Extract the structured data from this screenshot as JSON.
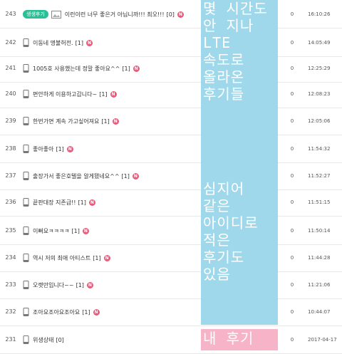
{
  "rows": [
    {
      "num": "243",
      "tag": "생생후기",
      "has_image": true,
      "title": "이런이런 너무 좋은거 아닙니까!!! 최오!!!",
      "reply": "[0]",
      "new": "N",
      "views": "0",
      "time": "16:10:26"
    },
    {
      "num": "242",
      "title": "이동네 명불허전.",
      "reply": "[1]",
      "new": "N",
      "views": "0",
      "time": "14:05:49"
    },
    {
      "num": "241",
      "title": "1005호 사용했는데 정말 좋아요^^",
      "reply": "[1]",
      "new": "N",
      "views": "0",
      "time": "12:25:29"
    },
    {
      "num": "240",
      "title": "편안하게 이용하고갑니다~",
      "reply": "[1]",
      "new": "N",
      "views": "0",
      "time": "12:08:23"
    },
    {
      "num": "239",
      "title": "한번가면 계속 가고싶어져요",
      "reply": "[1]",
      "new": "N",
      "views": "0",
      "time": "12:05:06"
    },
    {
      "num": "238",
      "title": "좋아좋아",
      "reply": "[1]",
      "new": "N",
      "views": "0",
      "time": "11:54:32"
    },
    {
      "num": "237",
      "title": "출장가서 좋은호텔을 알게됐네요^^",
      "reply": "[1]",
      "new": "N",
      "views": "0",
      "time": "11:52:27"
    },
    {
      "num": "236",
      "title": "끝판대장 지존급!!",
      "reply": "[1]",
      "new": "N",
      "views": "0",
      "time": "11:51:15"
    },
    {
      "num": "235",
      "title": "이뻐요ㅋㅋㅋㅋ",
      "reply": "[1]",
      "new": "N",
      "views": "0",
      "time": "11:50:14"
    },
    {
      "num": "234",
      "title": "역시 저의 최애 아티스트",
      "reply": "[1]",
      "new": "N",
      "views": "0",
      "time": "11:44:28"
    },
    {
      "num": "233",
      "title": "오랫만입니다~~",
      "reply": "[1]",
      "new": "N",
      "views": "0",
      "time": "11:21:06"
    },
    {
      "num": "232",
      "title": "조아요조아요조아요",
      "reply": "[1]",
      "new": "N",
      "views": "0",
      "time": "10:44:07"
    },
    {
      "num": "231",
      "title": "위생상태",
      "reply": "[0]",
      "new": "",
      "views": "0",
      "time": "2017-04-17"
    }
  ],
  "annotations": {
    "note1": "몇 시간도\n안 지나\nLTE\n속도로\n올라온\n후기들",
    "note2": "심지어\n같은\n아이디로\n적은\n후기도\n있음",
    "note3": "내 후기"
  },
  "colors": {
    "tag": "#2cbf96",
    "new_badge": "#e65c7b",
    "overlay_blue": "#9fd8ea",
    "overlay_pink": "#f7b3c8"
  }
}
